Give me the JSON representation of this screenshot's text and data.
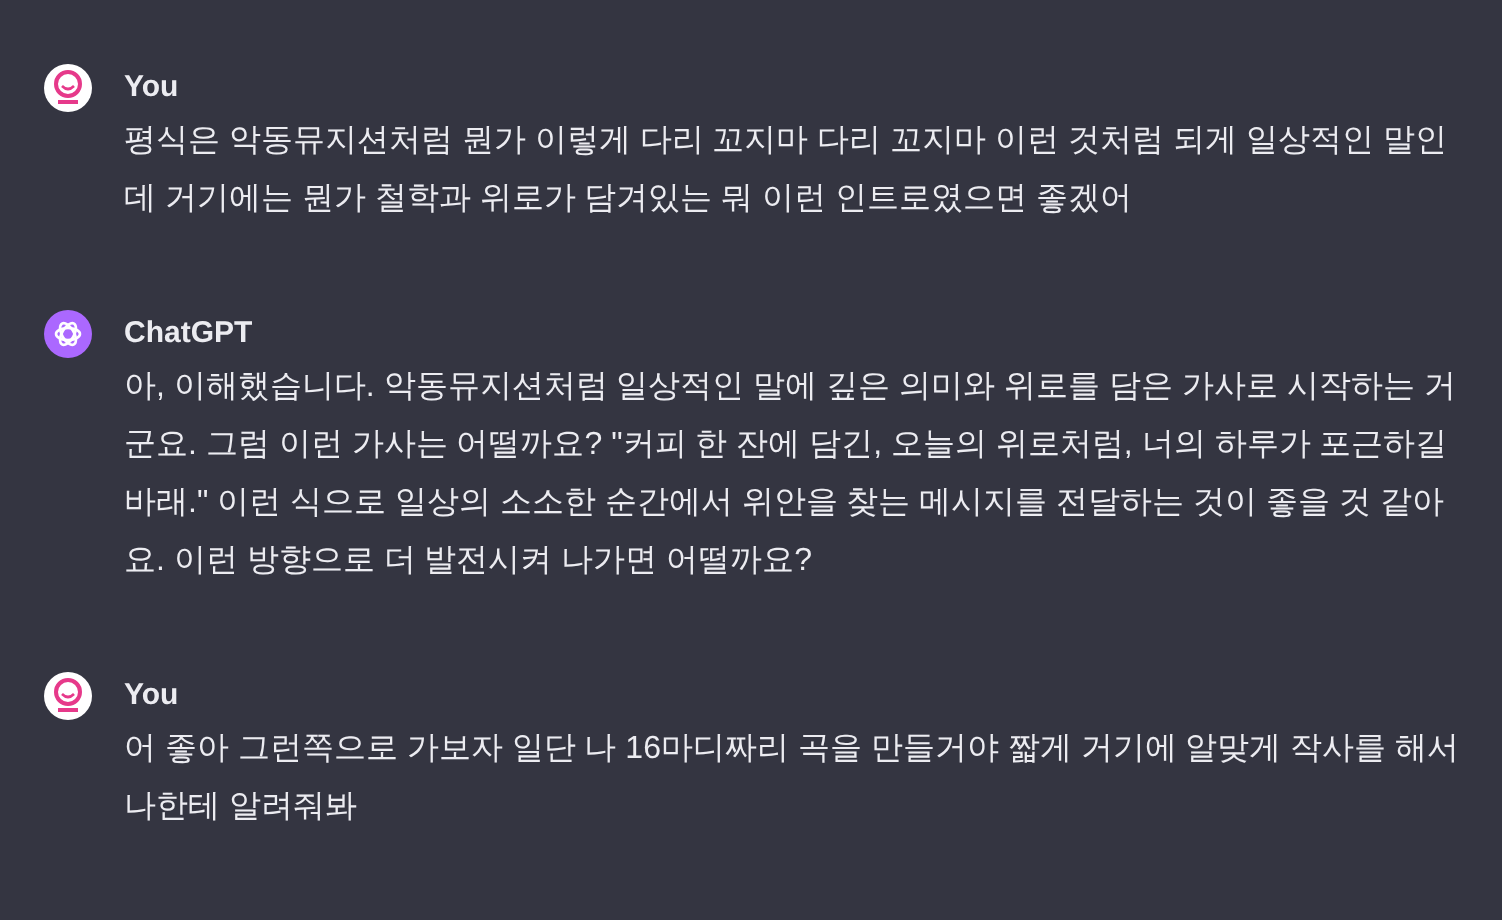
{
  "messages": [
    {
      "kind": "user",
      "author": "You",
      "text": "평식은 악동뮤지션처럼 뭔가 이렇게 다리 꼬지마 다리 꼬지마 이런 것처럼 되게 일상적인 말인데 거기에는 뭔가 철학과 위로가 담겨있는 뭐 이런 인트로였으면 좋겠어"
    },
    {
      "kind": "assistant",
      "author": "ChatGPT",
      "text": "아, 이해했습니다. 악동뮤지션처럼 일상적인 말에 깊은 의미와 위로를 담은 가사로 시작하는 거군요. 그럼 이런 가사는 어떨까요? \"커피 한 잔에 담긴, 오늘의 위로처럼, 너의 하루가 포근하길 바래.\" 이런 식으로 일상의 소소한 순간에서 위안을 찾는 메시지를 전달하는 것이 좋을 것 같아요. 이런 방향으로 더 발전시켜 나가면 어떨까요?"
    },
    {
      "kind": "user",
      "author": "You",
      "text": "어 좋아 그런쪽으로 가보자 일단 나 16마디짜리 곡을 만들거야 짧게 거기에 알맞게 작사를 해서 나한테 알려줘봐"
    }
  ]
}
